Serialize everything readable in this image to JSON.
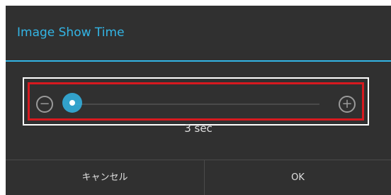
{
  "dialog": {
    "title": "Image Show Time",
    "accent_color": "#33b5e5",
    "highlight_color": "#d7191f"
  },
  "slider": {
    "decrease_icon": "minus-circle-icon",
    "increase_icon": "plus-circle-icon",
    "level": 0.0,
    "value_label": "3 sec"
  },
  "buttons": {
    "cancel_label": "キャンセル",
    "ok_label": "OK"
  }
}
